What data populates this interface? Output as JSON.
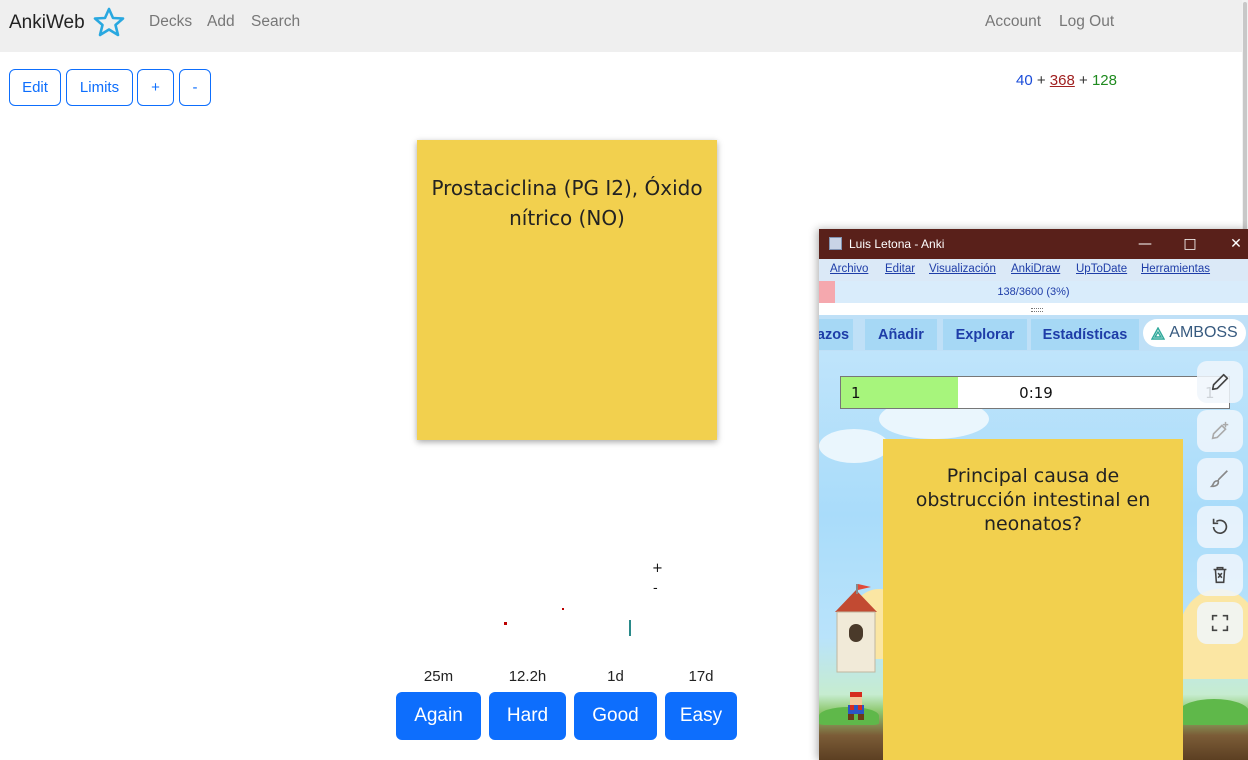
{
  "navbar": {
    "brand": "AnkiWeb",
    "links": [
      "Decks",
      "Add",
      "Search"
    ],
    "account": "Account",
    "logout": "Log Out"
  },
  "toolbar": {
    "edit": "Edit",
    "limits": "Limits",
    "plus": "+",
    "minus": "-"
  },
  "counts": {
    "new": "40",
    "sep1": "+",
    "learning": "368",
    "sep2": "+",
    "review": "128"
  },
  "card": {
    "front": "Prostaciclina (PG I2), Óxido nítrico (NO)"
  },
  "zoom": {
    "plus": "+",
    "minus": "-"
  },
  "answer": {
    "intervals": [
      "25m",
      "12.2h",
      "1d",
      "17d"
    ],
    "buttons": [
      "Again",
      "Hard",
      "Good",
      "Easy"
    ]
  },
  "anki_window": {
    "title": "Luis Letona - Anki",
    "menu": [
      "Archivo",
      "Editar",
      "Visualización",
      "AnkiDraw",
      "UpToDate",
      "Herramientas"
    ],
    "progress": "138/3600 (3%)",
    "progress_fraction": 0.038,
    "tabs": [
      "azos",
      "Añadir",
      "Explorar",
      "Estadísticas"
    ],
    "amboss": "AMBOSS",
    "timer": {
      "count": "1",
      "time": "0:19",
      "right": "1"
    },
    "card": {
      "front": "Principal causa de obstrucción intestinal en neonatos?"
    },
    "tools": [
      "pencil-icon",
      "pencil-plus-icon",
      "brush-icon",
      "undo-icon",
      "trash-icon",
      "fullscreen-icon"
    ]
  },
  "colors": {
    "accent": "#0d6efd",
    "card": "#f2d04e",
    "title_bar": "#59201a",
    "new": "#1a4cd9",
    "learning": "#a02020",
    "review": "#1f8a1f"
  }
}
